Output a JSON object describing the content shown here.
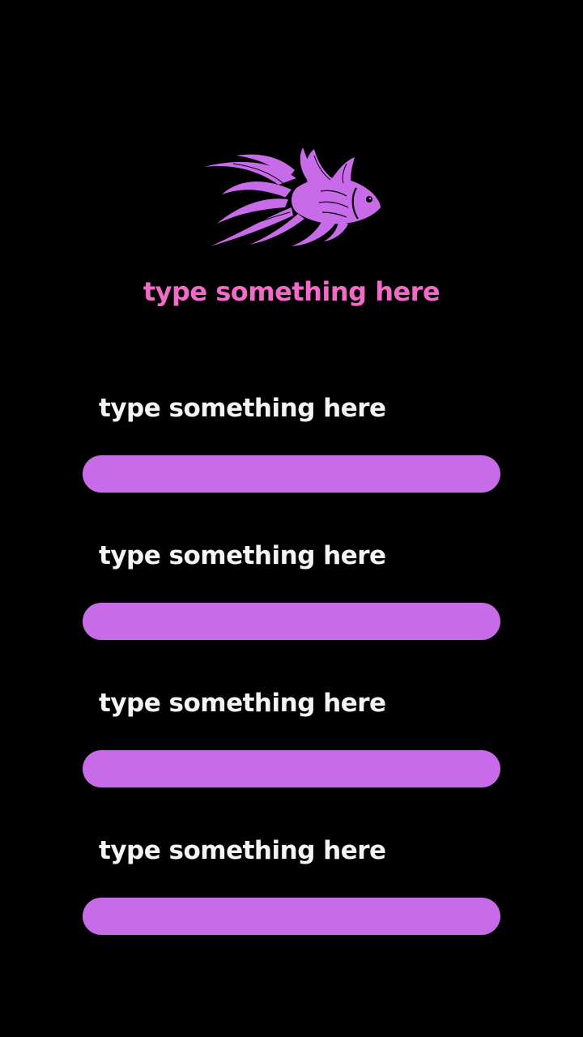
{
  "colors": {
    "background": "#000000",
    "accent": "#c86be8",
    "headline": "#f26bc8",
    "label": "#f4f4f4"
  },
  "logo": {
    "icon": "betta-fish-icon"
  },
  "headline": {
    "text": "type something here"
  },
  "fields": [
    {
      "label": "type something here",
      "value": ""
    },
    {
      "label": "type something here",
      "value": ""
    },
    {
      "label": "type something here",
      "value": ""
    },
    {
      "label": "type something here",
      "value": ""
    }
  ]
}
